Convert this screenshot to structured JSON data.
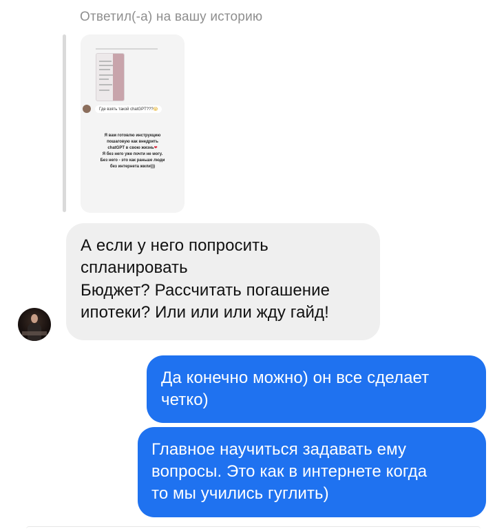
{
  "header": {
    "reply_label": "Ответил(-а) на вашу историю"
  },
  "story": {
    "question_text": "Где взять такой chatGPT???",
    "question_emoji": "😱",
    "answer_lines": [
      "Я вам готовлю инструкцию",
      "пошаговую как внедрить",
      "chatGPT в свою жизнь",
      "Я без него уже почти не могу.",
      "Без него - это как раньше люди",
      "без интернета жили)))"
    ],
    "heart": "❤"
  },
  "messages": [
    {
      "direction": "incoming",
      "lines": [
        "А если у него попросить спланировать",
        "Бюджет? Рассчитать погашение ипотеки? Или или или жду гайд!"
      ],
      "line_breaks": [
        [
          "А если у него попросить",
          "спланировать"
        ],
        [
          "Бюджет? Рассчитать погашение",
          "ипотеки? Или или или жду гайд!"
        ]
      ]
    },
    {
      "direction": "outgoing",
      "lines": [
        "Да конечно можно) он все сделает",
        "четко)"
      ]
    },
    {
      "direction": "outgoing",
      "lines": [
        "Главное научиться задавать ему",
        "вопросы. Это как в интернете когда",
        "то мы учились гуглить)"
      ]
    }
  ],
  "colors": {
    "outgoing_bubble": "#1f72f0",
    "incoming_bubble": "#efefef",
    "meta_text": "#8e8e8e"
  },
  "icons": {
    "sender_avatar": "avatar",
    "question_avatar": "avatar"
  }
}
